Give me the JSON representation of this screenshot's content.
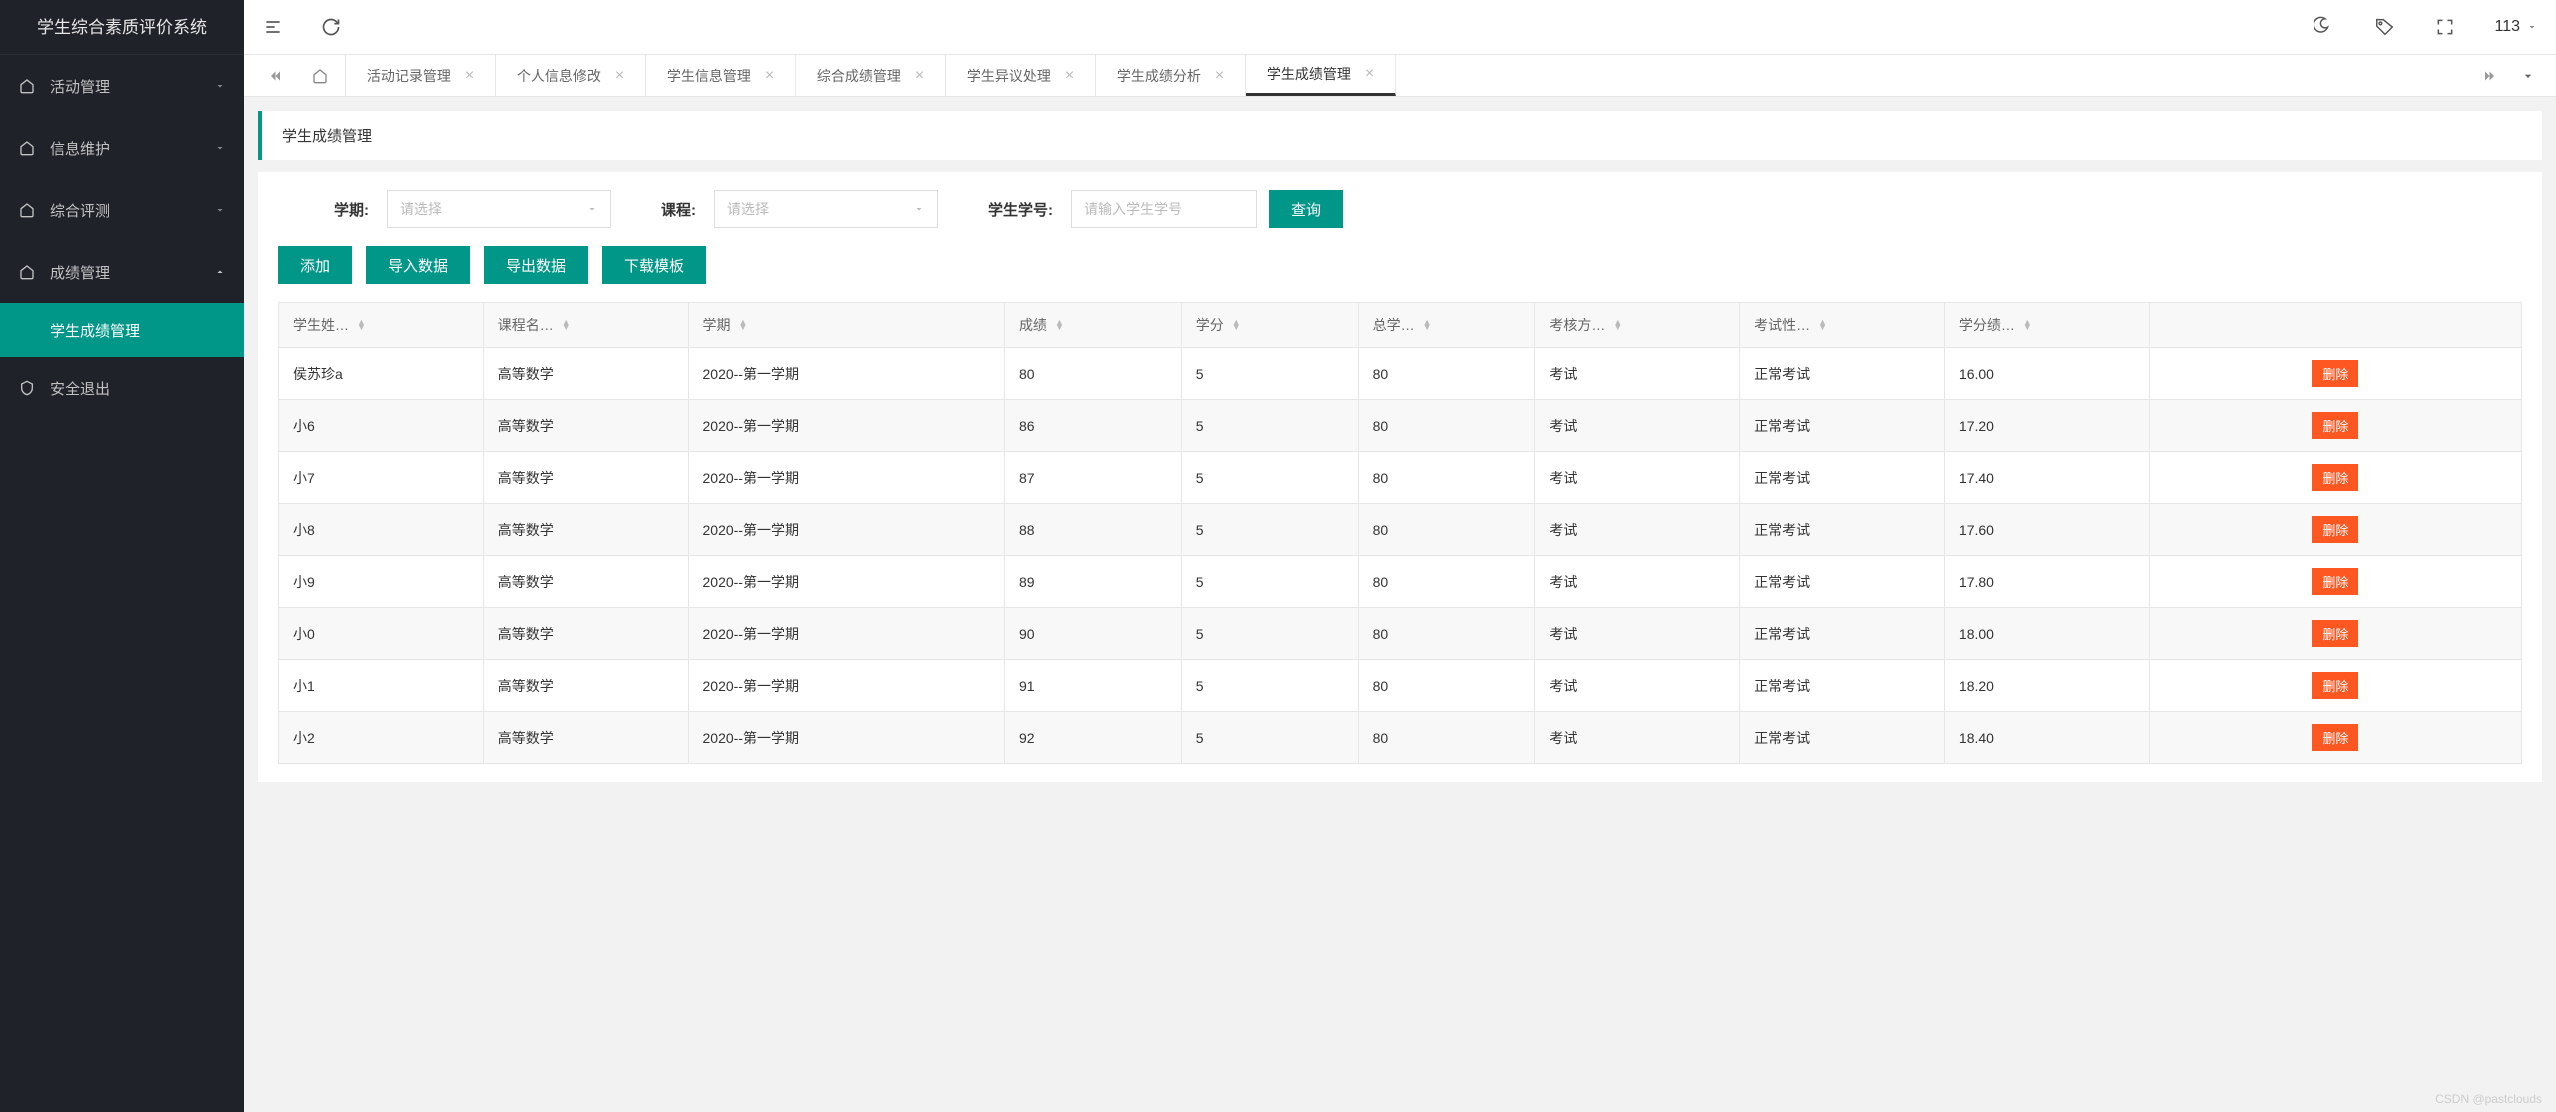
{
  "app_title": "学生综合素质评价系统",
  "sidebar": {
    "items": [
      {
        "label": "活动管理",
        "icon": "home"
      },
      {
        "label": "信息维护",
        "icon": "home"
      },
      {
        "label": "综合评测",
        "icon": "home"
      },
      {
        "label": "成绩管理",
        "icon": "home",
        "expanded": true,
        "children": [
          {
            "label": "学生成绩管理",
            "active": true
          }
        ]
      },
      {
        "label": "安全退出",
        "icon": "shield"
      }
    ]
  },
  "topbar": {
    "user_label": "113"
  },
  "tabs": {
    "items": [
      {
        "label": "活动记录管理"
      },
      {
        "label": "个人信息修改"
      },
      {
        "label": "学生信息管理"
      },
      {
        "label": "综合成绩管理"
      },
      {
        "label": "学生异议处理"
      },
      {
        "label": "学生成绩分析"
      },
      {
        "label": "学生成绩管理",
        "active": true
      }
    ]
  },
  "panel": {
    "title": "学生成绩管理"
  },
  "filters": {
    "semester_label": "学期:",
    "semester_placeholder": "请选择",
    "course_label": "课程:",
    "course_placeholder": "请选择",
    "student_id_label": "学生学号:",
    "student_id_placeholder": "请输入学生学号",
    "query_btn": "查询"
  },
  "actions": {
    "add": "添加",
    "import": "导入数据",
    "export": "导出数据",
    "download": "下载模板"
  },
  "table": {
    "headers": [
      "学生姓…",
      "课程名…",
      "学期",
      "成绩",
      "学分",
      "总学…",
      "考核方…",
      "考试性…",
      "学分绩…",
      ""
    ],
    "delete_label": "删除",
    "rows": [
      {
        "name": "侯苏珍a",
        "course": "高等数学",
        "semester": "2020--第一学期",
        "score": "80",
        "credit": "5",
        "total": "80",
        "method": "考试",
        "nature": "正常考试",
        "gpa": "16.00"
      },
      {
        "name": "小6",
        "course": "高等数学",
        "semester": "2020--第一学期",
        "score": "86",
        "credit": "5",
        "total": "80",
        "method": "考试",
        "nature": "正常考试",
        "gpa": "17.20"
      },
      {
        "name": "小7",
        "course": "高等数学",
        "semester": "2020--第一学期",
        "score": "87",
        "credit": "5",
        "total": "80",
        "method": "考试",
        "nature": "正常考试",
        "gpa": "17.40"
      },
      {
        "name": "小8",
        "course": "高等数学",
        "semester": "2020--第一学期",
        "score": "88",
        "credit": "5",
        "total": "80",
        "method": "考试",
        "nature": "正常考试",
        "gpa": "17.60"
      },
      {
        "name": "小9",
        "course": "高等数学",
        "semester": "2020--第一学期",
        "score": "89",
        "credit": "5",
        "total": "80",
        "method": "考试",
        "nature": "正常考试",
        "gpa": "17.80"
      },
      {
        "name": "小0",
        "course": "高等数学",
        "semester": "2020--第一学期",
        "score": "90",
        "credit": "5",
        "total": "80",
        "method": "考试",
        "nature": "正常考试",
        "gpa": "18.00"
      },
      {
        "name": "小1",
        "course": "高等数学",
        "semester": "2020--第一学期",
        "score": "91",
        "credit": "5",
        "total": "80",
        "method": "考试",
        "nature": "正常考试",
        "gpa": "18.20"
      },
      {
        "name": "小2",
        "course": "高等数学",
        "semester": "2020--第一学期",
        "score": "92",
        "credit": "5",
        "total": "80",
        "method": "考试",
        "nature": "正常考试",
        "gpa": "18.40"
      }
    ]
  },
  "watermark": "CSDN @pastclouds"
}
